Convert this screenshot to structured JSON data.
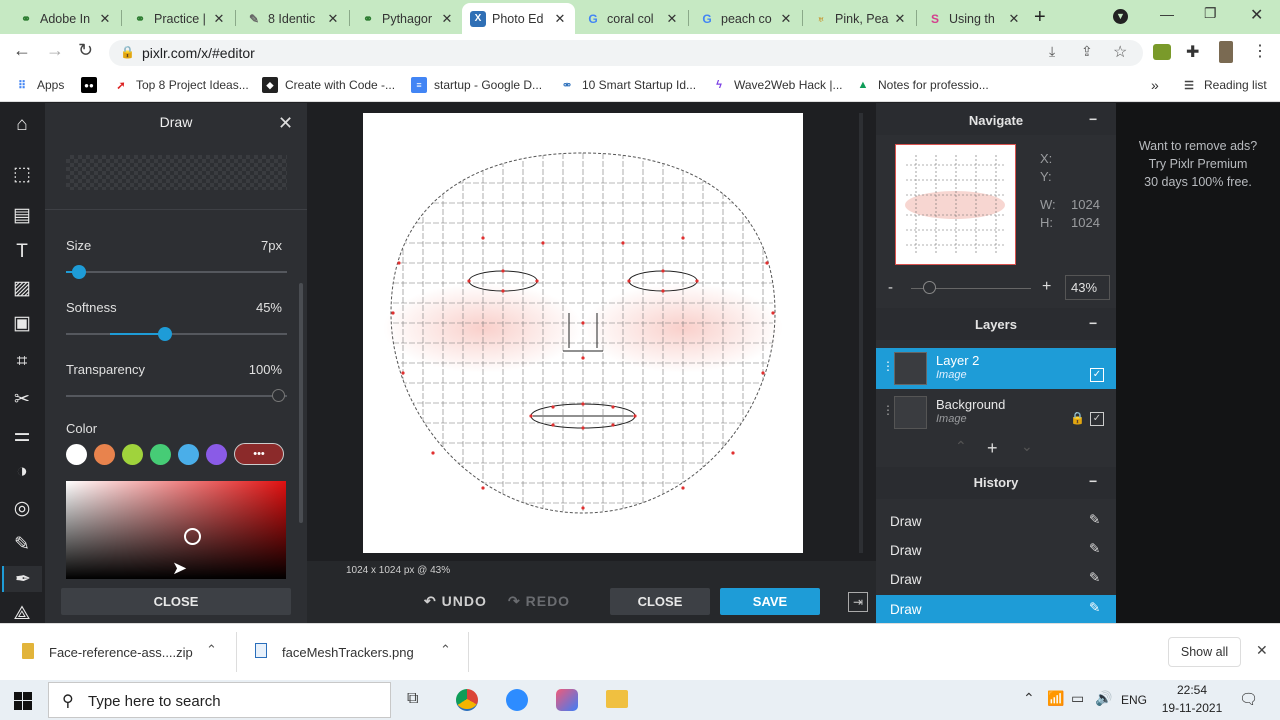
{
  "browser": {
    "tabs": [
      {
        "title": "Adobe In",
        "icon": "link-icon"
      },
      {
        "title": "Practice |",
        "icon": "link-icon"
      },
      {
        "title": "8 Identic",
        "icon": "page-icon"
      },
      {
        "title": "Pythagor",
        "icon": "link-icon"
      },
      {
        "title": "Photo Ed",
        "icon": "pixlr-icon"
      },
      {
        "title": "coral col",
        "icon": "google-icon"
      },
      {
        "title": "peach co",
        "icon": "google-icon"
      },
      {
        "title": "Pink, Pea",
        "icon": "shield-icon"
      },
      {
        "title": "Using th",
        "icon": "s-icon"
      }
    ],
    "url": "pixlr.com/x/#editor",
    "bookmarks": [
      {
        "label": "Apps"
      },
      {
        "label": ""
      },
      {
        "label": "Top 8 Project Ideas..."
      },
      {
        "label": "Create with Code -..."
      },
      {
        "label": "startup - Google D..."
      },
      {
        "label": "10 Smart Startup Id..."
      },
      {
        "label": "Wave2Web Hack |..."
      },
      {
        "label": "Notes for professio..."
      }
    ],
    "more_bookmarks": "»",
    "reading_list": "Reading list"
  },
  "draw_panel": {
    "title": "Draw",
    "size_label": "Size",
    "size_value": "7px",
    "size_fraction": 0.06,
    "softness_label": "Softness",
    "softness_value": "45%",
    "softness_fraction": 0.45,
    "transparency_label": "Transparency",
    "transparency_value": "100%",
    "color_label": "Color",
    "swatches": [
      "#ffffff",
      "#e8834d",
      "#a0d33c",
      "#46cc76",
      "#4aaee9",
      "#8a5be7"
    ],
    "more_label": "•••",
    "close_label": "CLOSE",
    "picker_hue": "#e01010"
  },
  "canvas": {
    "status": "1024 x 1024 px @ 43%"
  },
  "bottom_bar": {
    "undo": "UNDO",
    "redo": "REDO",
    "close": "CLOSE",
    "save": "SAVE"
  },
  "navigate": {
    "title": "Navigate",
    "x_label": "X:",
    "y_label": "Y:",
    "w_label": "W:",
    "w_value": "1024",
    "h_label": "H:",
    "h_value": "1024",
    "zoom_minus": "-",
    "zoom_plus": "+",
    "zoom_value": "43%"
  },
  "layers": {
    "title": "Layers",
    "items": [
      {
        "name": "Layer 2",
        "type": "Image"
      },
      {
        "name": "Background",
        "type": "Image"
      }
    ]
  },
  "history": {
    "title": "History",
    "items": [
      "Draw",
      "Draw",
      "Draw",
      "Draw"
    ]
  },
  "ad": {
    "line1": "Want to remove ads?",
    "line2": "Try Pixlr Premium",
    "line3": "30 days 100% free."
  },
  "downloads": {
    "items": [
      {
        "name": "Face-reference-ass....zip"
      },
      {
        "name": "faceMeshTrackers.png"
      }
    ],
    "show_all": "Show all"
  },
  "taskbar": {
    "search_placeholder": "Type here to search",
    "lang": "ENG",
    "time": "22:54",
    "date": "19-11-2021"
  }
}
